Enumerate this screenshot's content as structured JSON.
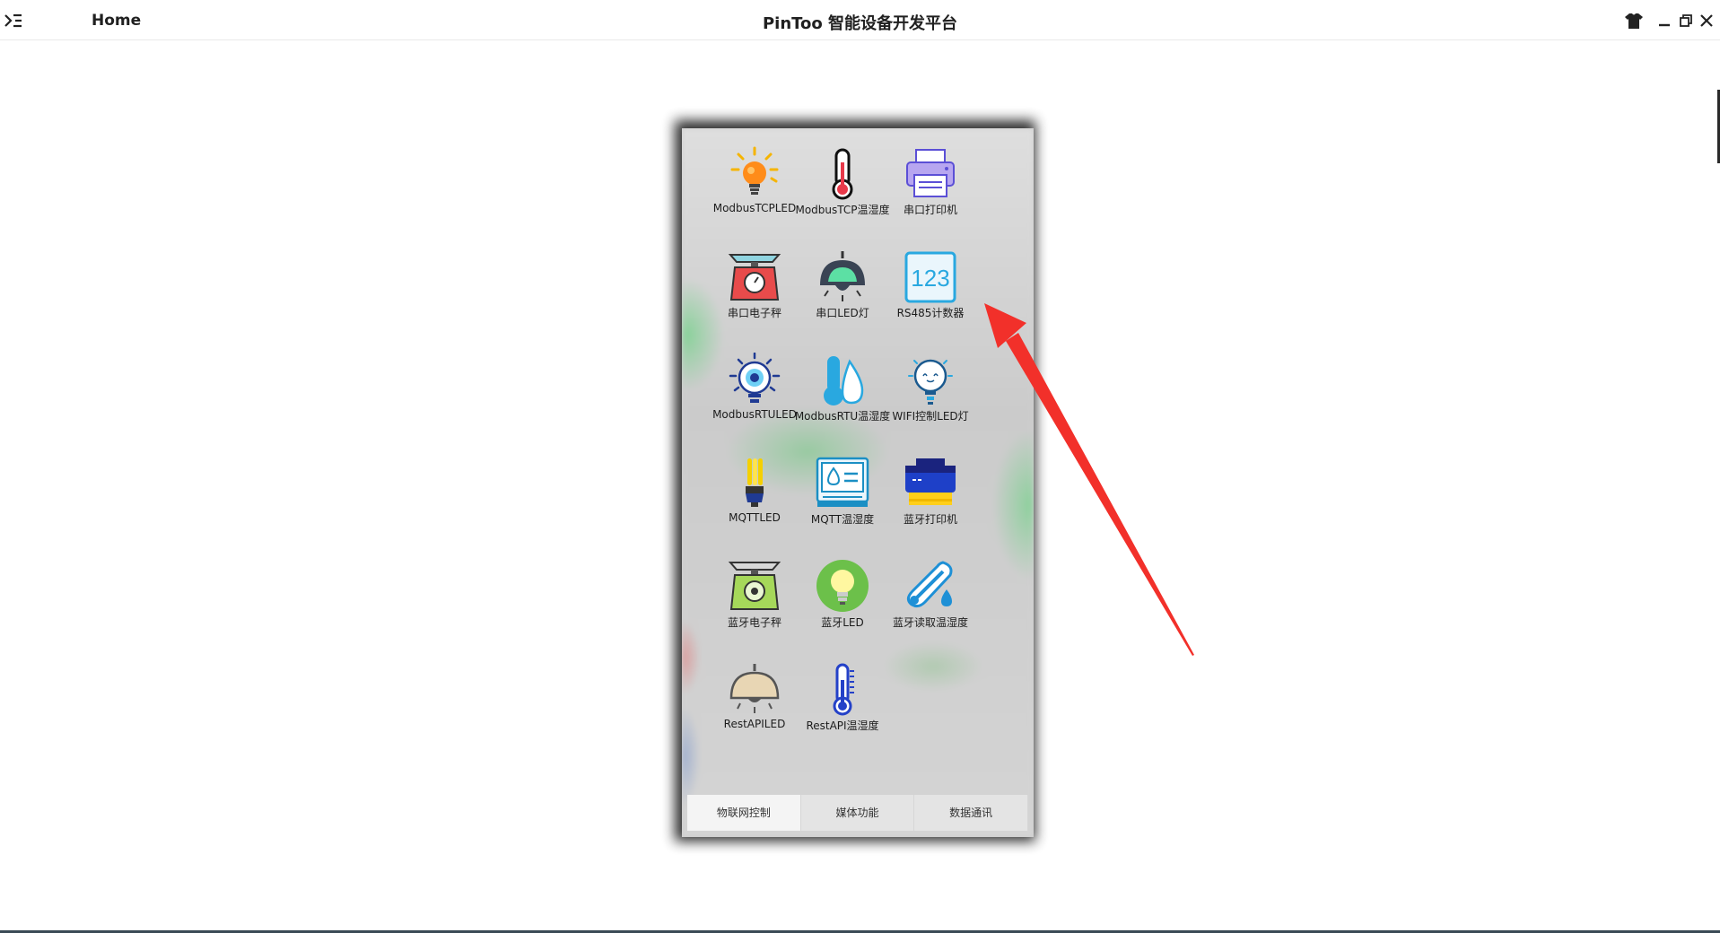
{
  "titlebar": {
    "home": "Home",
    "title": "PinToo 智能设备开发平台",
    "icons": [
      "menu-icon",
      "shirt-icon",
      "minimize-icon",
      "restore-icon",
      "close-icon"
    ]
  },
  "apps": [
    {
      "label": "ModbusTCPLED",
      "icon": "bulb-icon"
    },
    {
      "label": "ModbusTCP温湿度",
      "icon": "thermometer-icon"
    },
    {
      "label": "串口打印机",
      "icon": "printer-icon"
    },
    {
      "label": "串口电子秤",
      "icon": "scale-icon"
    },
    {
      "label": "串口LED灯",
      "icon": "lamp-icon"
    },
    {
      "label": "RS485计数器",
      "icon": "counter-icon"
    },
    {
      "label": "ModbusRTULED",
      "icon": "bulb-ring-icon"
    },
    {
      "label": "ModbusRTU温湿度",
      "icon": "thermo-drop-icon"
    },
    {
      "label": "WIFI控制LED灯",
      "icon": "smile-bulb-icon"
    },
    {
      "label": "MQTTLED",
      "icon": "cfl-bulb-icon"
    },
    {
      "label": "MQTT温湿度",
      "icon": "humidity-panel-icon"
    },
    {
      "label": "蓝牙打印机",
      "icon": "blue-printer-icon"
    },
    {
      "label": "蓝牙电子秤",
      "icon": "green-scale-icon"
    },
    {
      "label": "蓝牙LED",
      "icon": "green-bulb-icon"
    },
    {
      "label": "蓝牙读取温湿度",
      "icon": "probe-thermometer-icon"
    },
    {
      "label": "RestAPILED",
      "icon": "pendant-lamp-icon"
    },
    {
      "label": "RestAPI温湿度",
      "icon": "blue-thermometer-icon"
    }
  ],
  "counter_text": "123",
  "tabs": [
    {
      "label": "物联网控制",
      "active": true
    },
    {
      "label": "媒体功能",
      "active": false
    },
    {
      "label": "数据通讯",
      "active": false
    }
  ],
  "colors": {
    "arrow": "#f2302a",
    "counter_blue": "#29a8e0"
  }
}
